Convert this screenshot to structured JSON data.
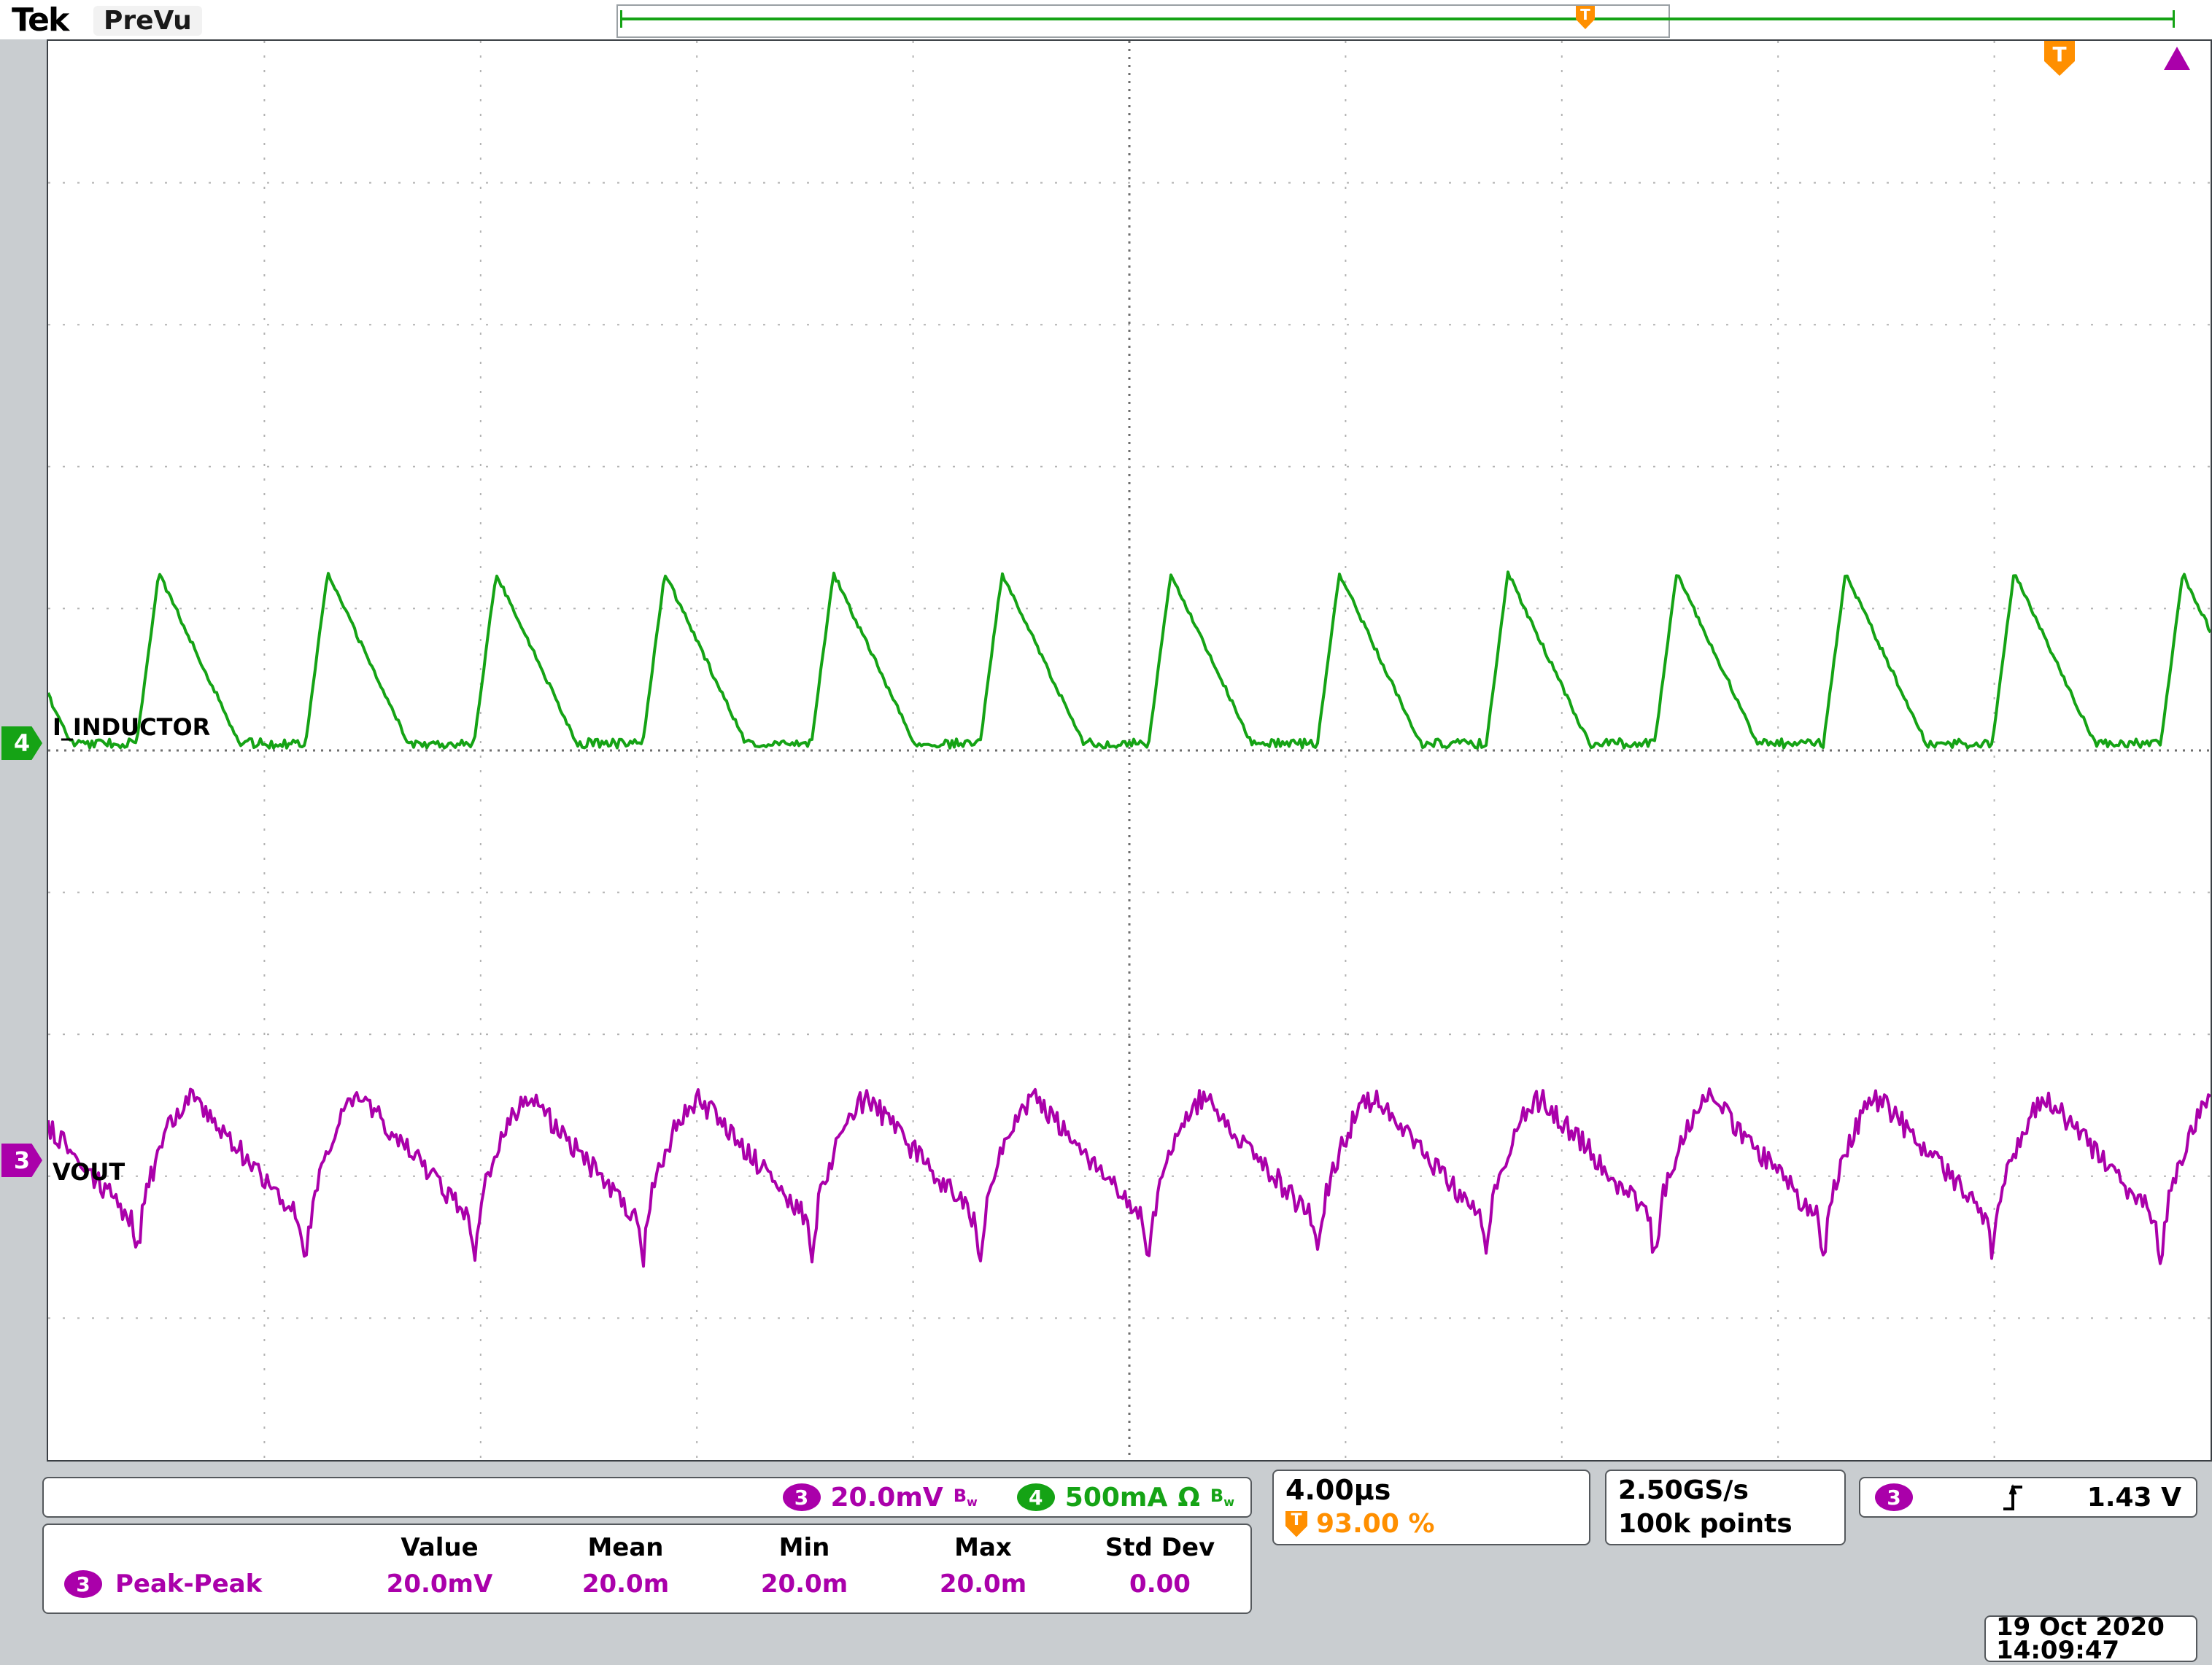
{
  "header": {
    "logo": "Tek",
    "mode": "PreVu"
  },
  "icons": {
    "trigger_letter": "T",
    "bandwidth_b": "B",
    "bandwidth_w": "w"
  },
  "channels": {
    "ch3": {
      "number": "3",
      "label": "VOUT",
      "color": "#aa00aa"
    },
    "ch4": {
      "number": "4",
      "label": "I_INDUCTOR",
      "color": "#15a315"
    }
  },
  "readouts": {
    "ch3_scale": "20.0mV",
    "ch4_scale": "500mA",
    "ch4_impedance": "Ω",
    "timebase": "4.00µs",
    "trigger_position": "93.00 %",
    "sample_rate": "2.50GS/s",
    "record_length": "100k points",
    "trigger_level": "1.43 V"
  },
  "measurements": {
    "headers": [
      "Value",
      "Mean",
      "Min",
      "Max",
      "Std Dev"
    ],
    "row": {
      "channel": "3",
      "name": "Peak-Peak",
      "value": "20.0mV",
      "mean": "20.0m",
      "min": "20.0m",
      "max": "20.0m",
      "std_dev": "0.00"
    }
  },
  "datetime": {
    "date": "19 Oct 2020",
    "time": "14:09:47"
  },
  "chart_data": {
    "type": "line",
    "title": "Oscilloscope acquisition: buck converter DCM inductor current and output ripple",
    "grid": {
      "x_divisions": 10,
      "y_divisions": 10
    },
    "x_axis": {
      "scale_per_div": "4.00µs",
      "total_span": "40µs"
    },
    "trigger": {
      "source_channel": "3",
      "level": "1.43 V",
      "position_percent": 93.0
    },
    "first_pulse_start_fraction": 0.041,
    "series": [
      {
        "name": "I_INDUCTOR",
        "channel": 4,
        "color": "#15a315",
        "vertical_scale": "500mA/div",
        "shape": "dcm-inductor-current",
        "period_divisions": 0.78,
        "peak_divisions": 1.2,
        "baseline_offset_divisions": 0.05,
        "rise_fraction": 0.13,
        "fall_fraction": 0.48
      },
      {
        "name": "VOUT",
        "channel": 3,
        "color": "#aa00aa",
        "vertical_scale": "20.0mV/div",
        "shape": "switching-ripple-sawtooth",
        "period_divisions": 0.78,
        "peak_to_peak_divisions": 0.88,
        "center_offset_divisions": 2.9,
        "rise_fraction": 0.34,
        "noise_divisions": 0.08,
        "measured_peak_to_peak": "20.0mV"
      }
    ]
  }
}
